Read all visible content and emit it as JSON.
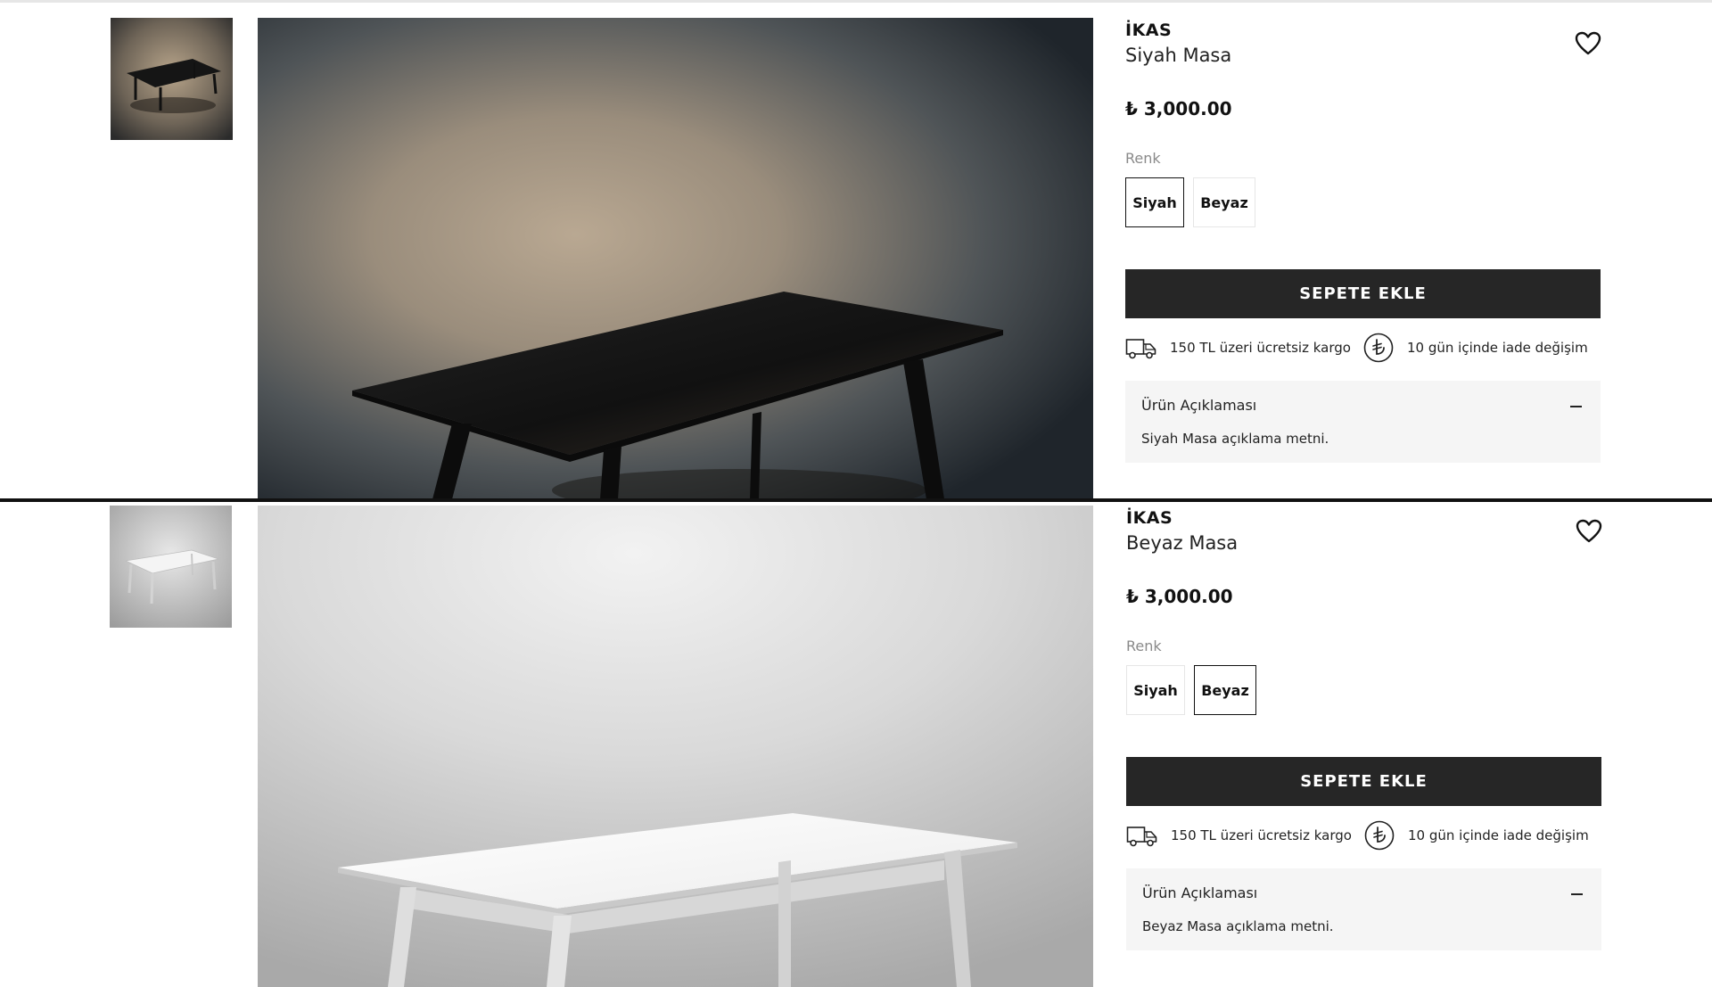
{
  "products": [
    {
      "brand": "İKAS",
      "name": "Siyah Masa",
      "price": "₺ 3,000.00",
      "color_label": "Renk",
      "color_options": [
        "Siyah",
        "Beyaz"
      ],
      "selected_color": "Siyah",
      "add_to_cart": "SEPETE EKLE",
      "features": [
        {
          "icon": "truck-icon",
          "text": "150 TL üzeri ücretsiz kargo"
        },
        {
          "icon": "lira-icon",
          "text": "10 gün içinde iade değişim"
        }
      ],
      "description_title": "Ürün Açıklaması",
      "description_text": "Siyah Masa açıklama metni."
    },
    {
      "brand": "İKAS",
      "name": "Beyaz Masa",
      "price": "₺ 3,000.00",
      "color_label": "Renk",
      "color_options": [
        "Siyah",
        "Beyaz"
      ],
      "selected_color": "Beyaz",
      "add_to_cart": "SEPETE EKLE",
      "features": [
        {
          "icon": "truck-icon",
          "text": "150 TL üzeri ücretsiz kargo"
        },
        {
          "icon": "lira-icon",
          "text": "10 gün içinde iade değişim"
        }
      ],
      "description_title": "Ürün Açıklaması",
      "description_text": "Beyaz Masa açıklama metni."
    }
  ],
  "icons": {
    "wishlist": "heart-icon",
    "collapse": "minus-icon"
  },
  "colors": {
    "button_bg": "#262626",
    "accordion_bg": "#f5f5f5",
    "text": "#111111"
  }
}
